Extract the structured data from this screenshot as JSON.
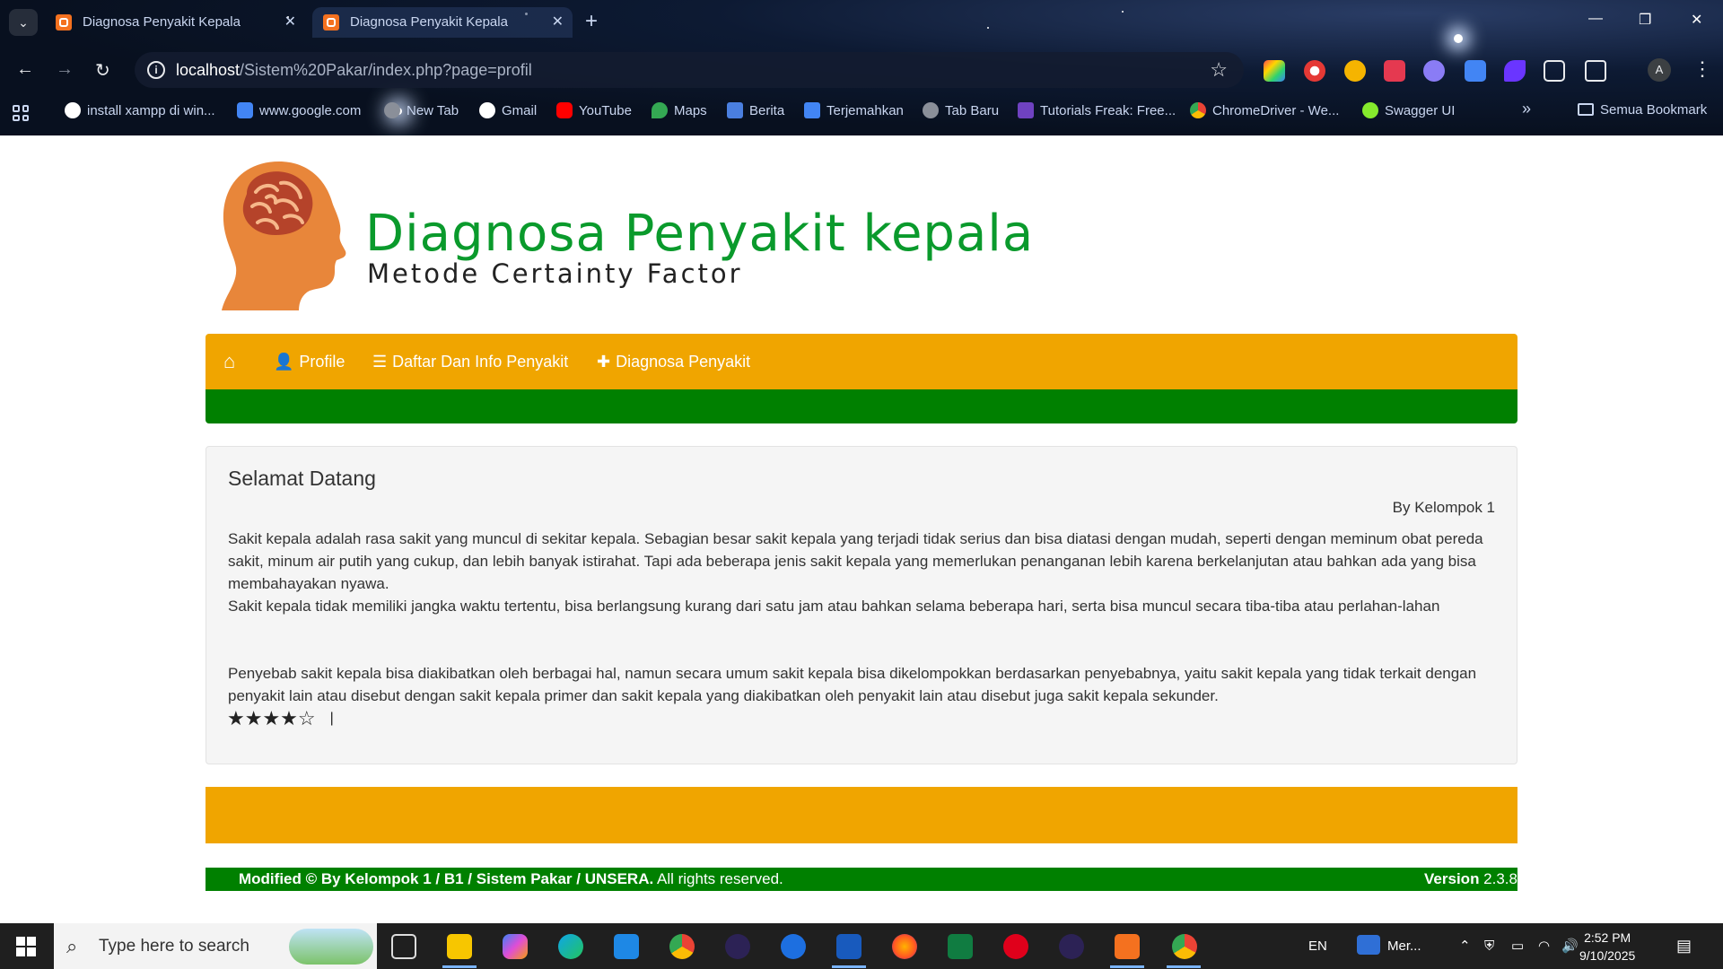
{
  "browser": {
    "tabs": [
      {
        "title": "Diagnosa Penyakit Kepala",
        "active": false
      },
      {
        "title": "Diagnosa Penyakit Kepala",
        "active": true
      }
    ],
    "url_host": "localhost",
    "url_path": "/Sistem%20Pakar/index.php?page=profil",
    "profile_initial": "A",
    "bookmarks": [
      {
        "label": "install xampp di win...",
        "icon": "google-icon"
      },
      {
        "label": "www.google.com",
        "icon": "search-icon"
      },
      {
        "label": "New Tab",
        "icon": "globe-icon"
      },
      {
        "label": "Gmail",
        "icon": "google-icon"
      },
      {
        "label": "YouTube",
        "icon": "youtube-icon"
      },
      {
        "label": "Maps",
        "icon": "maps-icon"
      },
      {
        "label": "Berita",
        "icon": "news-icon"
      },
      {
        "label": "Terjemahkan",
        "icon": "translate-icon"
      },
      {
        "label": "Tab Baru",
        "icon": "globe-icon"
      },
      {
        "label": "Tutorials Freak: Free...",
        "icon": "tutorials-icon"
      },
      {
        "label": "ChromeDriver - We...",
        "icon": "chrome-icon"
      },
      {
        "label": "Swagger UI",
        "icon": "swagger-icon"
      }
    ],
    "all_bookmarks": "Semua Bookmark"
  },
  "site": {
    "brand_title": "Diagnosa Penyakit kepala",
    "brand_subtitle": "Metode Certainty Factor",
    "nav": [
      {
        "label": "",
        "icon": "home-icon"
      },
      {
        "label": "Profile",
        "icon": "user-icon"
      },
      {
        "label": "Daftar Dan Info Penyakit",
        "icon": "list-icon"
      },
      {
        "label": "Diagnosa Penyakit",
        "icon": "plus-icon"
      }
    ],
    "panel": {
      "heading": "Selamat Datang",
      "byline": "By Kelompok 1",
      "paragraph1": "Sakit kepala adalah rasa sakit yang muncul di sekitar kepala. Sebagian besar sakit kepala yang terjadi tidak serius dan bisa diatasi dengan mudah, seperti dengan meminum obat pereda sakit, minum air putih yang cukup, dan lebih banyak istirahat. Tapi ada beberapa jenis sakit kepala yang memerlukan penanganan lebih karena berkelanjutan atau bahkan ada yang bisa membahayakan nyawa.",
      "paragraph1b": "Sakit kepala tidak memiliki jangka waktu tertentu, bisa berlangsung kurang dari satu jam atau bahkan selama beberapa hari, serta bisa muncul secara tiba-tiba atau perlahan-lahan",
      "paragraph2": "Penyebab sakit kepala bisa diakibatkan oleh berbagai hal, namun secara umum sakit kepala bisa dikelompokkan berdasarkan penyebabnya, yaitu sakit kepala yang tidak terkait dengan penyakit lain atau disebut dengan sakit kepala primer dan sakit kepala yang diakibatkan oleh penyakit lain atau disebut juga sakit kepala sekunder.",
      "rating_stars": "★★★★☆",
      "rating_value": 4,
      "rating_max": 5,
      "rating_cursor": "|"
    },
    "footer": {
      "left_bold": "Modified © By Kelompok 1 / B1 / Sistem Pakar / UNSERA.",
      "left_rest": " All rights reserved.",
      "right_bold": "Version",
      "right_rest": " 2.3.8"
    },
    "colors": {
      "orange": "#f0a500",
      "green": "#008000",
      "brand_green": "#0a9a2c",
      "logo_orange": "#e8863a"
    }
  },
  "taskbar": {
    "search_placeholder": "Type here to search",
    "language": "EN",
    "widget_label": "Mer...",
    "time": "2:52 PM",
    "date": "9/10/2025"
  }
}
